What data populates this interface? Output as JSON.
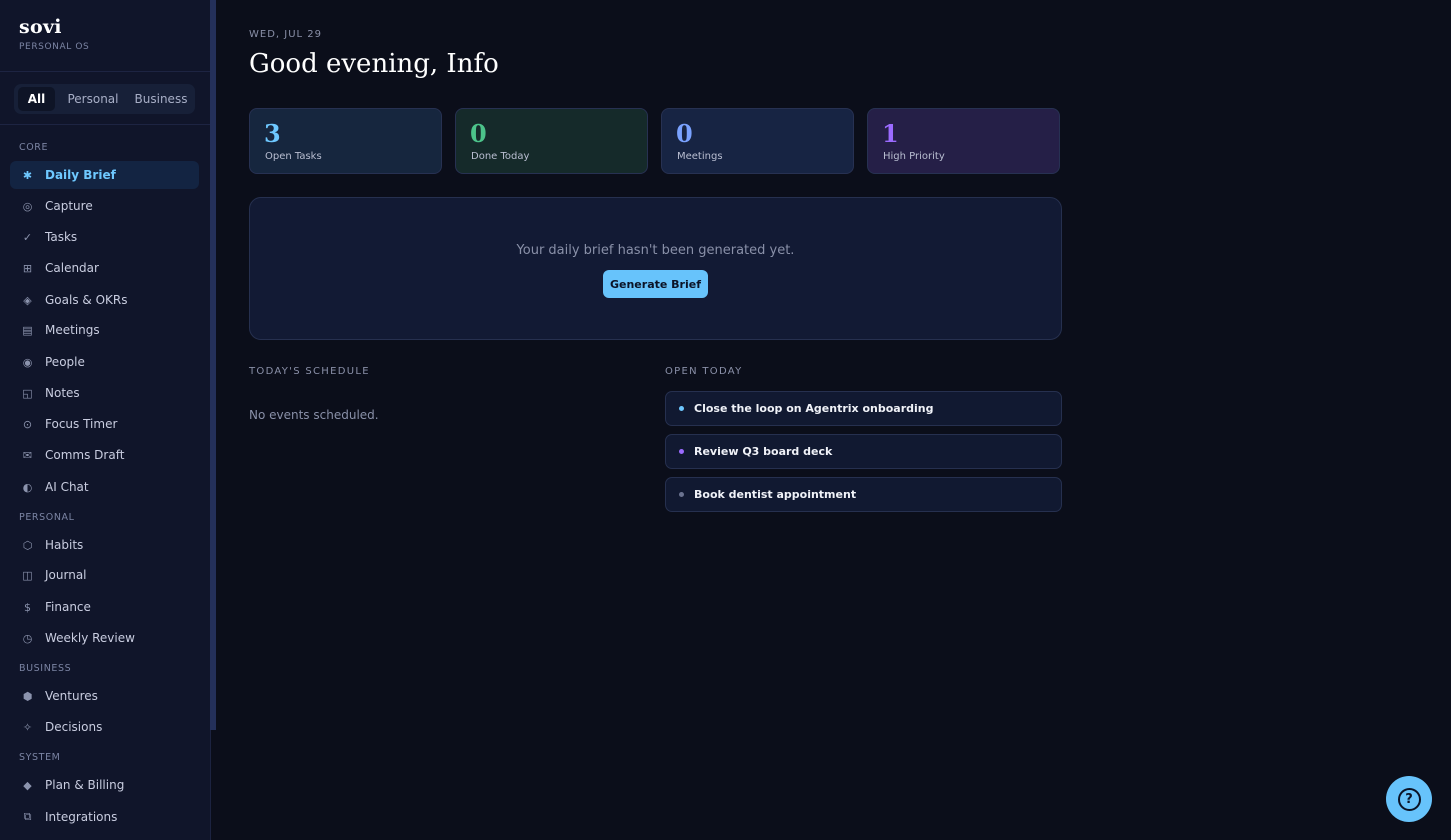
{
  "brand": {
    "name": "sovi",
    "subtitle": "PERSONAL OS"
  },
  "scope_tabs": [
    {
      "label": "All",
      "active": true
    },
    {
      "label": "Personal",
      "active": false
    },
    {
      "label": "Business",
      "active": false
    }
  ],
  "sidebar": {
    "sections": [
      {
        "title": "CORE",
        "items": [
          {
            "label": "Daily Brief",
            "icon": "asterisk-icon",
            "glyph": "✱",
            "active": true
          },
          {
            "label": "Capture",
            "icon": "capture-icon",
            "glyph": "◎"
          },
          {
            "label": "Tasks",
            "icon": "check-icon",
            "glyph": "✓"
          },
          {
            "label": "Calendar",
            "icon": "calendar-grid-icon",
            "glyph": "⊞"
          },
          {
            "label": "Goals & OKRs",
            "icon": "diamond-target-icon",
            "glyph": "◈"
          },
          {
            "label": "Meetings",
            "icon": "meetings-icon",
            "glyph": "▤"
          },
          {
            "label": "People",
            "icon": "people-icon",
            "glyph": "◉"
          },
          {
            "label": "Notes",
            "icon": "notes-icon",
            "glyph": "◱"
          },
          {
            "label": "Focus Timer",
            "icon": "timer-icon",
            "glyph": "⊙"
          },
          {
            "label": "Comms Draft",
            "icon": "mail-icon",
            "glyph": "✉"
          },
          {
            "label": "AI Chat",
            "icon": "half-circle-icon",
            "glyph": "◐"
          }
        ]
      },
      {
        "title": "PERSONAL",
        "items": [
          {
            "label": "Habits",
            "icon": "hexagon-icon",
            "glyph": "⬡"
          },
          {
            "label": "Journal",
            "icon": "journal-icon",
            "glyph": "◫"
          },
          {
            "label": "Finance",
            "icon": "dollar-icon",
            "glyph": "$"
          },
          {
            "label": "Weekly Review",
            "icon": "clock-icon",
            "glyph": "◷"
          }
        ]
      },
      {
        "title": "BUSINESS",
        "items": [
          {
            "label": "Ventures",
            "icon": "hexagon-filled-icon",
            "glyph": "⬢"
          },
          {
            "label": "Decisions",
            "icon": "sparkle-icon",
            "glyph": "✧"
          }
        ]
      },
      {
        "title": "SYSTEM",
        "items": [
          {
            "label": "Plan & Billing",
            "icon": "diamond-icon",
            "glyph": "◆"
          },
          {
            "label": "Integrations",
            "icon": "integrations-icon",
            "glyph": "⧉"
          }
        ]
      }
    ]
  },
  "header": {
    "date": "WED, JUL 29",
    "greeting": "Good evening, Info"
  },
  "stats": [
    {
      "value": "3",
      "label": "Open Tasks",
      "color": "#6ec8ff",
      "bg": "#16263e"
    },
    {
      "value": "0",
      "label": "Done Today",
      "color": "#4cc38a",
      "bg": "#152a2a"
    },
    {
      "value": "0",
      "label": "Meetings",
      "color": "#7aa2ff",
      "bg": "#172443"
    },
    {
      "value": "1",
      "label": "High Priority",
      "color": "#9b6bff",
      "bg": "#251f47"
    }
  ],
  "brief": {
    "message": "Your daily brief hasn't been generated yet.",
    "button": "Generate Brief"
  },
  "schedule": {
    "title": "TODAY'S SCHEDULE",
    "empty": "No events scheduled."
  },
  "open_today": {
    "title": "OPEN TODAY",
    "tasks": [
      {
        "title": "Close the loop on Agentrix onboarding",
        "dot_color": "#6ec8ff"
      },
      {
        "title": "Review Q3 board deck",
        "dot_color": "#9b6bff"
      },
      {
        "title": "Book dentist appointment",
        "dot_color": "#6b7390"
      }
    ]
  },
  "help": {
    "icon": "help-icon",
    "glyph": "?"
  }
}
